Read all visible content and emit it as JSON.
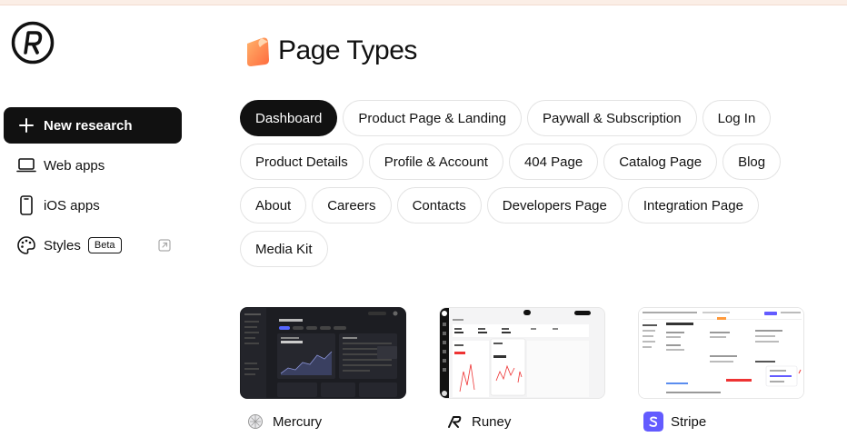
{
  "sidebar": {
    "items": [
      {
        "label": "New research",
        "icon": "plus-icon"
      },
      {
        "label": "Web apps",
        "icon": "laptop-icon"
      },
      {
        "label": "iOS apps",
        "icon": "phone-icon"
      },
      {
        "label": "Styles",
        "icon": "palette-icon",
        "badge": "Beta"
      }
    ]
  },
  "main": {
    "title": "Page Types",
    "chips": [
      {
        "label": "Dashboard",
        "active": true
      },
      {
        "label": "Product Page & Landing"
      },
      {
        "label": "Paywall & Subscription"
      },
      {
        "label": "Log In"
      },
      {
        "label": "Product Details"
      },
      {
        "label": "Profile & Account"
      },
      {
        "label": "404 Page"
      },
      {
        "label": "Catalog Page"
      },
      {
        "label": "Blog"
      },
      {
        "label": "About"
      },
      {
        "label": "Careers"
      },
      {
        "label": "Contacts"
      },
      {
        "label": "Developers Page"
      },
      {
        "label": "Integration Page"
      },
      {
        "label": "Media Kit"
      }
    ],
    "cards": [
      {
        "name": "Mercury",
        "brand_icon": "mercury-logo-icon"
      },
      {
        "name": "Runey",
        "brand_icon": "runey-logo-icon"
      },
      {
        "name": "Stripe",
        "brand_icon": "stripe-logo-icon",
        "brand_color": "#635bff"
      }
    ]
  },
  "colors": {
    "primary": "#111111",
    "chip_border": "#e3e3e3",
    "accent_strip": "#fbeee6"
  }
}
